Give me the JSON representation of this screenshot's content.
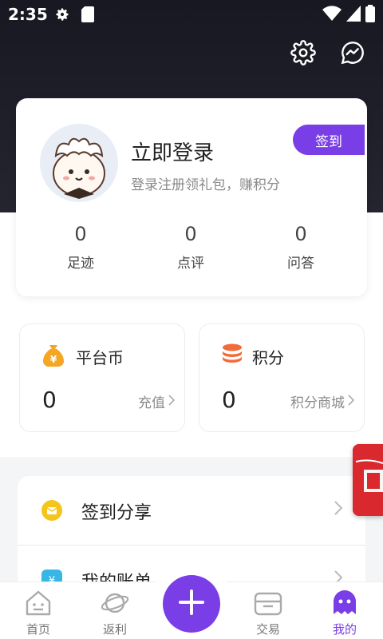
{
  "status_bar": {
    "time": "2:35",
    "icons": [
      "gear-icon",
      "sd-card-icon",
      "wifi-icon",
      "signal-icon",
      "battery-icon"
    ]
  },
  "header": {
    "actions": [
      "settings-icon",
      "message-icon"
    ]
  },
  "profile": {
    "title": "立即登录",
    "subtitle": "登录注册领礼包，赚积分",
    "signin_label": "签到",
    "stats": [
      {
        "value": "0",
        "label": "足迹"
      },
      {
        "value": "0",
        "label": "点评"
      },
      {
        "value": "0",
        "label": "问答"
      }
    ]
  },
  "wallet": {
    "coins": {
      "title": "平台币",
      "value": "0",
      "link": "充值",
      "icon": "coin-bag-icon"
    },
    "points": {
      "title": "积分",
      "value": "0",
      "link": "积分商城",
      "icon": "coin-stack-icon"
    }
  },
  "menu": {
    "items": [
      {
        "label": "签到分享",
        "icon": "signin-share-icon"
      },
      {
        "label": "我的账单",
        "icon": "bill-icon"
      }
    ]
  },
  "bottom_nav": {
    "items": [
      {
        "label": "首页",
        "icon": "home-icon"
      },
      {
        "label": "返利",
        "icon": "planet-icon"
      },
      {
        "label": "交易",
        "icon": "trade-box-icon"
      },
      {
        "label": "我的",
        "icon": "ghost-icon"
      }
    ],
    "active": "我的"
  },
  "colors": {
    "accent": "#7a3ee6",
    "header_dark": "#1e1e28",
    "coin_yellow": "#f5a623",
    "points_orange": "#f26b3a",
    "red_packet": "#d9282e"
  }
}
